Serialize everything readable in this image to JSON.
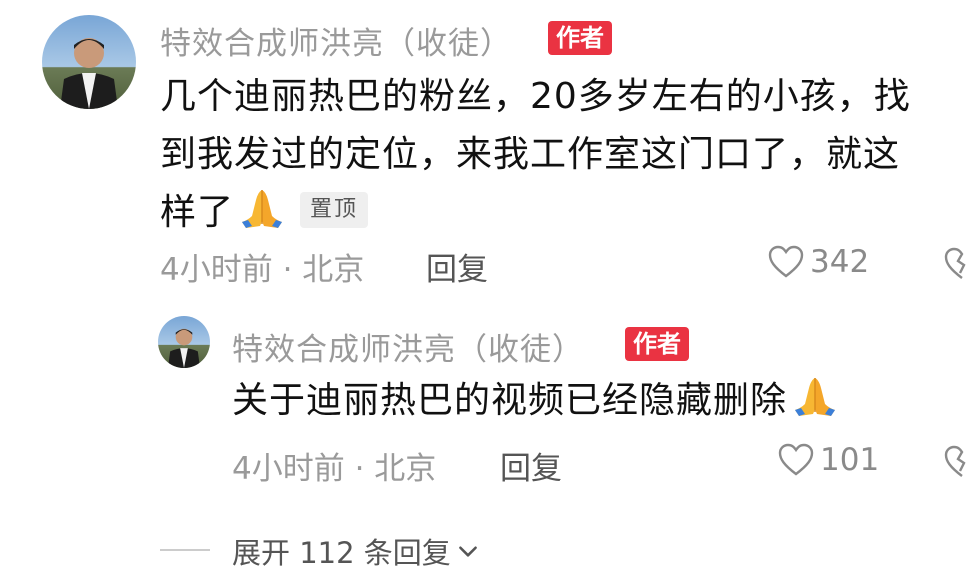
{
  "comment": {
    "username": "特效合成师洪亮（收徒）",
    "author_badge": "作者",
    "text_line1": "几个迪丽热巴的粉丝，20多岁左右的小孩，找",
    "text_line2": "到我发过的定位，来我工作室这门口了，就这",
    "text_line3": "样了",
    "emoji": "folded-hands",
    "pinned_label": "置顶",
    "meta": "4小时前 · 北京",
    "reply_label": "回复",
    "likes": "342"
  },
  "reply": {
    "username": "特效合成师洪亮（收徒）",
    "author_badge": "作者",
    "text": "关于迪丽热巴的视频已经隐藏删除",
    "emoji": "folded-hands",
    "meta": "4小时前 · 北京",
    "reply_label": "回复",
    "likes": "101"
  },
  "expand": {
    "label": "展开 112 条回复",
    "icon": "chevron-down-icon"
  },
  "colors": {
    "author_badge": "#ea3342",
    "meta_gray": "#9a9a9a",
    "text": "#111111"
  }
}
